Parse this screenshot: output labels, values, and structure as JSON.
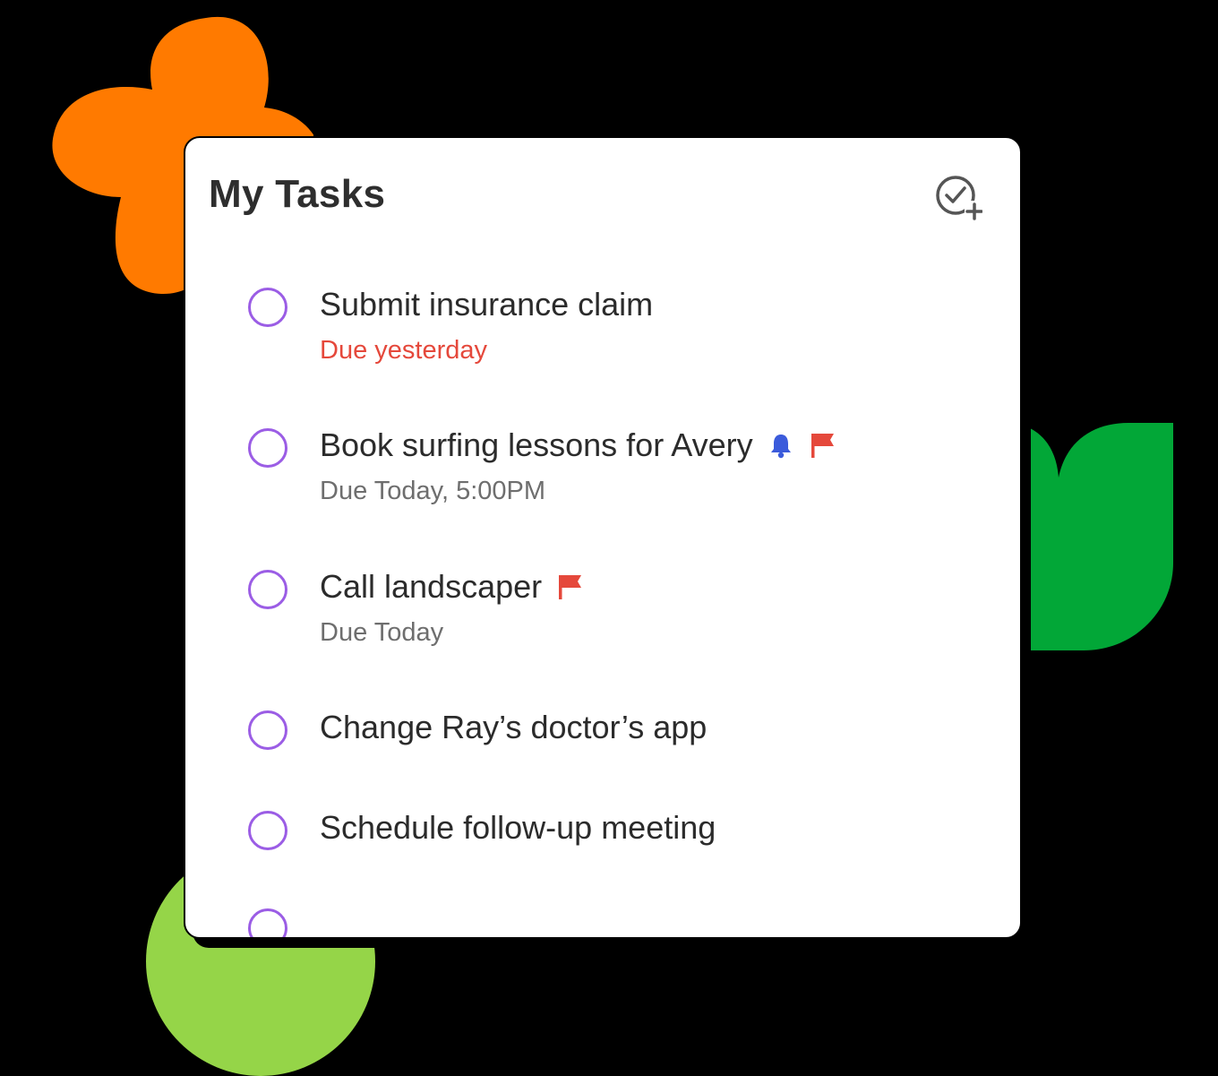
{
  "colors": {
    "background": "#000000",
    "orange": "#ff7a00",
    "green": "#02a737",
    "lime": "#95d548",
    "checkbox": "#9b5de5",
    "overdue": "#e5483b",
    "due_gray": "#6e6e6e",
    "bell": "#3b5bdb",
    "flag": "#e5483b"
  },
  "card": {
    "title": "My Tasks",
    "add_icon": "check-circle-plus-icon"
  },
  "tasks": [
    {
      "title": "Submit insurance claim",
      "due": "Due yesterday",
      "overdue": true,
      "icons": []
    },
    {
      "title": "Book surfing lessons for Avery",
      "due": "Due Today, 5:00PM",
      "overdue": false,
      "icons": [
        "bell-icon",
        "flag-icon"
      ]
    },
    {
      "title": "Call landscaper",
      "due": "Due Today",
      "overdue": false,
      "icons": [
        "flag-icon"
      ]
    },
    {
      "title": "Change Ray’s doctor’s app",
      "due": "",
      "overdue": false,
      "icons": []
    },
    {
      "title": "Schedule follow-up meeting",
      "due": "",
      "overdue": false,
      "icons": []
    }
  ]
}
